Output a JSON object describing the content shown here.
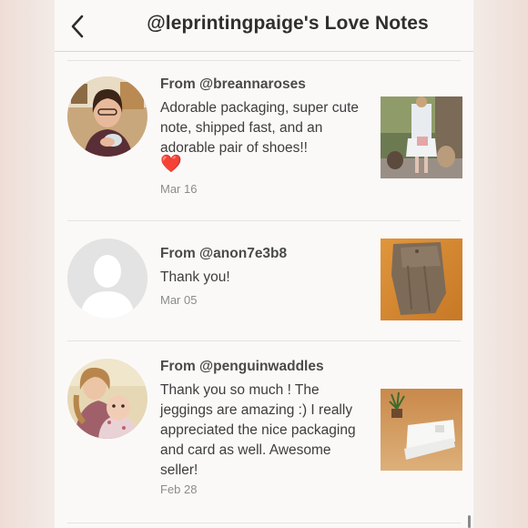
{
  "header": {
    "title": "@leprintingpaige's Love Notes",
    "back_icon": "chevron-left-icon"
  },
  "notes": [
    {
      "from": "From @breannaroses",
      "text": "Adorable packaging, super cute note, shipped fast, and an adorable pair of shoes!!",
      "emoji": "❤️",
      "date": "Mar 16"
    },
    {
      "from": "From @anon7e3b8",
      "text": "Thank you!",
      "date": "Mar 05"
    },
    {
      "from": "From @penguinwaddles",
      "text": "Thank you so much ! The jeggings are amazing :) I really appreciated the nice packaging and card as well. Awesome seller!",
      "date": "Feb 28"
    }
  ]
}
